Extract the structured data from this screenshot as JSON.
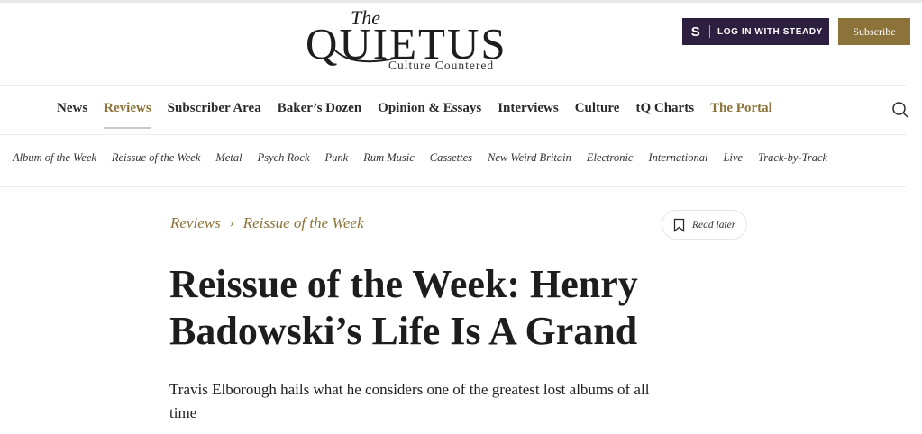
{
  "header": {
    "logo_the": "The",
    "logo_main": "QUIETUS",
    "logo_tagline": "Culture Countered",
    "steady_letter": "S",
    "steady_label": "LOG IN WITH STEADY",
    "subscribe_label": "Subscribe"
  },
  "mainnav": {
    "items": [
      {
        "label": "News"
      },
      {
        "label": "Reviews"
      },
      {
        "label": "Subscriber Area"
      },
      {
        "label": "Baker’s Dozen"
      },
      {
        "label": "Opinion & Essays"
      },
      {
        "label": "Interviews"
      },
      {
        "label": "Culture"
      },
      {
        "label": "tQ Charts"
      },
      {
        "label": "The Portal"
      }
    ]
  },
  "subnav": {
    "items": [
      {
        "label": "Album of the Week"
      },
      {
        "label": "Reissue of the Week"
      },
      {
        "label": "Metal"
      },
      {
        "label": "Psych Rock"
      },
      {
        "label": "Punk"
      },
      {
        "label": "Rum Music"
      },
      {
        "label": "Cassettes"
      },
      {
        "label": "New Weird Britain"
      },
      {
        "label": "Electronic"
      },
      {
        "label": "International"
      },
      {
        "label": "Live"
      },
      {
        "label": "Track-by-Track"
      }
    ]
  },
  "breadcrumb": {
    "level1": "Reviews",
    "level2": "Reissue of the Week"
  },
  "article": {
    "read_later_label": "Read later",
    "title": "Reissue of the Week: Henry Badowski’s Life Is A Grand",
    "standfirst": "Travis Elborough hails what he considers one of the greatest lost albums of all time"
  },
  "colors": {
    "accent_gold": "#8c7339",
    "steady_purple": "#2d1f40"
  }
}
